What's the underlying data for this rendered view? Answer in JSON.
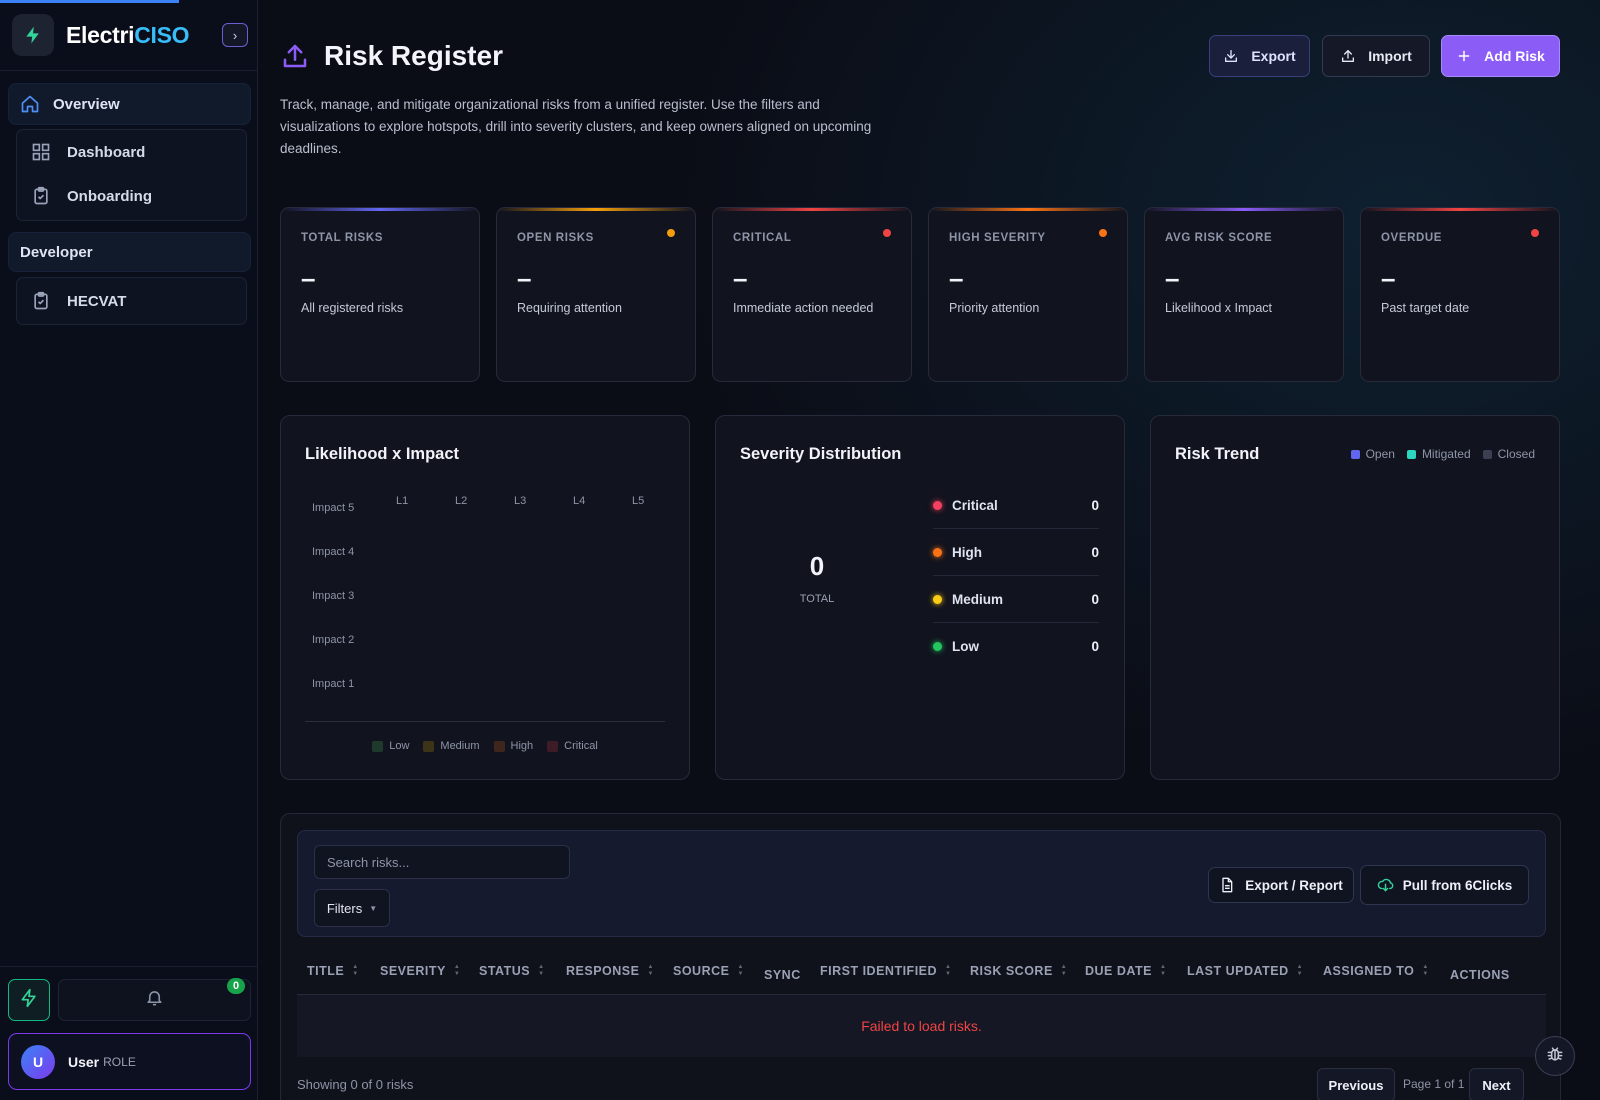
{
  "brand": {
    "name_main": "Electri",
    "name_accent": "CISO"
  },
  "sidebar": {
    "overview_label": "Overview",
    "items": [
      {
        "label": "Dashboard"
      },
      {
        "label": "Onboarding"
      }
    ],
    "developer_label": "Developer",
    "developer_items": [
      {
        "label": "HECVAT"
      }
    ],
    "notifications_count": "0",
    "user": {
      "initial": "U",
      "name": "User",
      "role": "ROLE"
    }
  },
  "header": {
    "title": "Risk Register",
    "description": "Track, manage, and mitigate organizational risks from a unified register. Use the filters and visualizations to explore hotspots, drill into severity clusters, and keep owners aligned on upcoming deadlines.",
    "export_label": "Export",
    "import_label": "Import",
    "add_label": "Add Risk"
  },
  "stats": [
    {
      "label": "TOTAL RISKS",
      "value": "–",
      "sub": "All registered risks",
      "accent": "#6366f1",
      "dot": ""
    },
    {
      "label": "OPEN RISKS",
      "value": "–",
      "sub": "Requiring attention",
      "accent": "#f59e0b",
      "dot": "#f59e0b"
    },
    {
      "label": "CRITICAL",
      "value": "–",
      "sub": "Immediate action needed",
      "accent": "#ef4444",
      "dot": "#ef4444"
    },
    {
      "label": "HIGH SEVERITY",
      "value": "–",
      "sub": "Priority attention",
      "accent": "#f97316",
      "dot": "#f97316"
    },
    {
      "label": "AVG RISK SCORE",
      "value": "–",
      "sub": "Likelihood x Impact",
      "accent": "#8b5cf6",
      "dot": ""
    },
    {
      "label": "OVERDUE",
      "value": "–",
      "sub": "Past target date",
      "accent": "#ef4444",
      "dot": "#ef4444"
    }
  ],
  "heatmap": {
    "title": "Likelihood x Impact",
    "columns": [
      "L1",
      "L2",
      "L3",
      "L4",
      "L5"
    ],
    "rows": [
      "Impact 5",
      "Impact 4",
      "Impact 3",
      "Impact 2",
      "Impact 1"
    ],
    "legend": [
      {
        "label": "Low",
        "color": "#1f3a2c"
      },
      {
        "label": "Medium",
        "color": "#3d3418"
      },
      {
        "label": "High",
        "color": "#3f261c"
      },
      {
        "label": "Critical",
        "color": "#3d1c26"
      }
    ]
  },
  "severity": {
    "title": "Severity Distribution",
    "total": "0",
    "total_label": "TOTAL",
    "items": [
      {
        "label": "Critical",
        "value": "0",
        "color": "#f43f5e"
      },
      {
        "label": "High",
        "value": "0",
        "color": "#f97316"
      },
      {
        "label": "Medium",
        "value": "0",
        "color": "#facc15"
      },
      {
        "label": "Low",
        "value": "0",
        "color": "#22c55e"
      }
    ]
  },
  "trend": {
    "title": "Risk Trend",
    "legend": [
      {
        "label": "Open",
        "color": "#6366f1"
      },
      {
        "label": "Mitigated",
        "color": "#2dd4bf"
      },
      {
        "label": "Closed",
        "color": "#3a3f52"
      }
    ]
  },
  "table": {
    "search_placeholder": "Search risks...",
    "filters_label": "Filters",
    "export_report_label": "Export / Report",
    "pull_label": "Pull from 6Clicks",
    "columns": [
      {
        "label": "TITLE",
        "sortable": true
      },
      {
        "label": "SEVERITY",
        "sortable": true
      },
      {
        "label": "STATUS",
        "sortable": true
      },
      {
        "label": "RESPONSE",
        "sortable": true
      },
      {
        "label": "SOURCE",
        "sortable": true
      },
      {
        "label": "SYNC",
        "sortable": false
      },
      {
        "label": "FIRST IDENTIFIED",
        "sortable": true
      },
      {
        "label": "RISK SCORE",
        "sortable": true
      },
      {
        "label": "DUE DATE",
        "sortable": true
      },
      {
        "label": "LAST UPDATED",
        "sortable": true
      },
      {
        "label": "ASSIGNED TO",
        "sortable": true
      },
      {
        "label": "ACTIONS",
        "sortable": false
      }
    ],
    "empty_message": "Failed to load risks.",
    "showing_text": "Showing 0 of 0 risks",
    "prev_label": "Previous",
    "page_info": "Page 1 of 1",
    "next_label": "Next"
  }
}
